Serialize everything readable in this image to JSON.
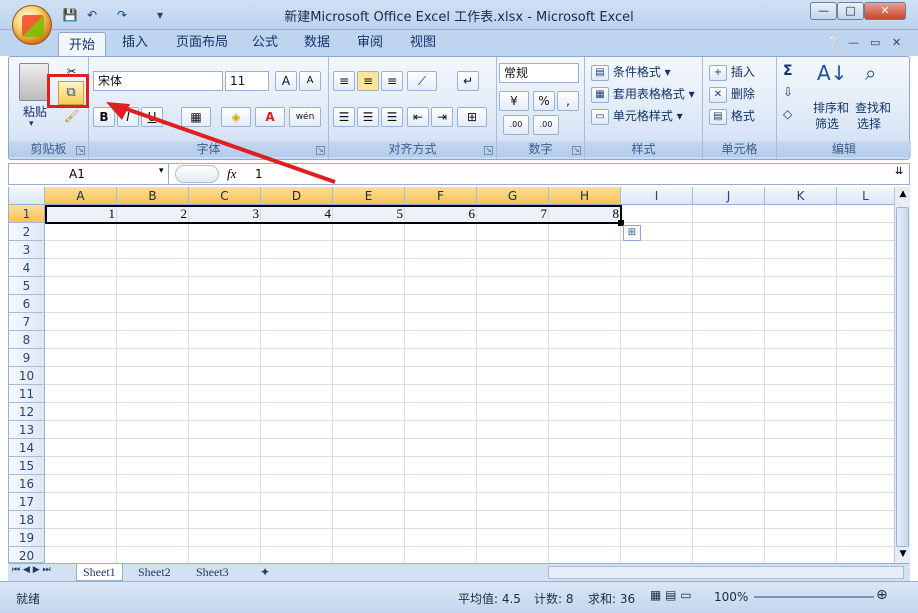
{
  "window": {
    "title": "新建Microsoft Office Excel 工作表.xlsx - Microsoft Excel",
    "min": "—",
    "max": "□",
    "close": "✕"
  },
  "qat": {
    "save": "💾",
    "undo": "↶",
    "redo": "↷",
    "customize": "▾"
  },
  "tabs": [
    "开始",
    "插入",
    "页面布局",
    "公式",
    "数据",
    "审阅",
    "视图"
  ],
  "ribbon": {
    "clipboard": {
      "paste": "粘贴",
      "label": "剪贴板"
    },
    "font": {
      "name": "宋体",
      "size": "11",
      "bold": "B",
      "italic": "I",
      "underline": "U",
      "grow": "A",
      "shrink": "A",
      "font_color": "A",
      "phonetic": "wén",
      "label": "字体"
    },
    "alignment": {
      "label": "对齐方式"
    },
    "number": {
      "format": "常规",
      "percent": "%",
      "comma": ",",
      "inc": ".00",
      "dec": ".00",
      "label": "数字"
    },
    "styles": {
      "cond": "条件格式",
      "table": "套用表格格式",
      "cell": "单元格样式",
      "label": "样式"
    },
    "cells": {
      "insert": "插入",
      "delete": "删除",
      "format": "格式",
      "label": "单元格"
    },
    "editing": {
      "sum": "Σ",
      "sort": "排序和",
      "sort2": "筛选",
      "find": "查找和",
      "find2": "选择",
      "label": "编辑"
    }
  },
  "formula": {
    "namebox": "A1",
    "fx": "fx",
    "value": "1"
  },
  "grid": {
    "columns": [
      "A",
      "B",
      "C",
      "D",
      "E",
      "F",
      "G",
      "H",
      "I",
      "J",
      "K",
      "L"
    ],
    "rows": [
      "1",
      "2",
      "3",
      "4",
      "5",
      "6",
      "7",
      "8",
      "9",
      "10",
      "11",
      "12",
      "13",
      "14",
      "15",
      "16",
      "17",
      "18",
      "19",
      "20"
    ],
    "row1": [
      "1",
      "2",
      "3",
      "4",
      "5",
      "6",
      "7",
      "8"
    ]
  },
  "sheets": [
    "Sheet1",
    "Sheet2",
    "Sheet3"
  ],
  "status": {
    "ready": "就绪",
    "avg": "平均值: 4.5",
    "count": "计数: 8",
    "sum": "求和: 36",
    "zoom": "100%"
  },
  "colors": {
    "highlight": "#e02020",
    "arrow": "#e02020"
  }
}
